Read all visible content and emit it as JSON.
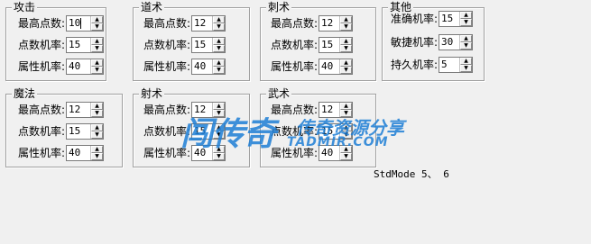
{
  "groups": [
    {
      "title": "攻击",
      "rows": [
        {
          "label": "最高点数:",
          "value": "10"
        },
        {
          "label": "点数机率:",
          "value": "15"
        },
        {
          "label": "属性机率:",
          "value": "40"
        }
      ]
    },
    {
      "title": "道术",
      "rows": [
        {
          "label": "最高点数:",
          "value": "12"
        },
        {
          "label": "点数机率:",
          "value": "15"
        },
        {
          "label": "属性机率:",
          "value": "40"
        }
      ]
    },
    {
      "title": "刺术",
      "rows": [
        {
          "label": "最高点数:",
          "value": "12"
        },
        {
          "label": "点数机率:",
          "value": "15"
        },
        {
          "label": "属性机率:",
          "value": "40"
        }
      ]
    },
    {
      "title": "其他",
      "rows": [
        {
          "label": "准确机率:",
          "value": "15"
        },
        {
          "label": "敏捷机率:",
          "value": "30"
        },
        {
          "label": "持久机率:",
          "value": "5"
        }
      ]
    },
    {
      "title": "魔法",
      "rows": [
        {
          "label": "最高点数:",
          "value": "12"
        },
        {
          "label": "点数机率:",
          "value": "15"
        },
        {
          "label": "属性机率:",
          "value": "40"
        }
      ]
    },
    {
      "title": "射术",
      "rows": [
        {
          "label": "最高点数:",
          "value": "12"
        },
        {
          "label": "点数机率:",
          "value": "15"
        },
        {
          "label": "属性机率:",
          "value": "40"
        }
      ]
    },
    {
      "title": "武术",
      "rows": [
        {
          "label": "最高点数:",
          "value": "12"
        },
        {
          "label": "点数机率:",
          "value": "15"
        },
        {
          "label": "属性机率:",
          "value": "40"
        }
      ]
    }
  ],
  "note": "StdMode 5、 6",
  "watermark": {
    "big": "闯传奇",
    "cn": "传奇资源分享",
    "url": "TADMIR.COM"
  },
  "arrows": {
    "up": "▲",
    "down": "▼"
  }
}
